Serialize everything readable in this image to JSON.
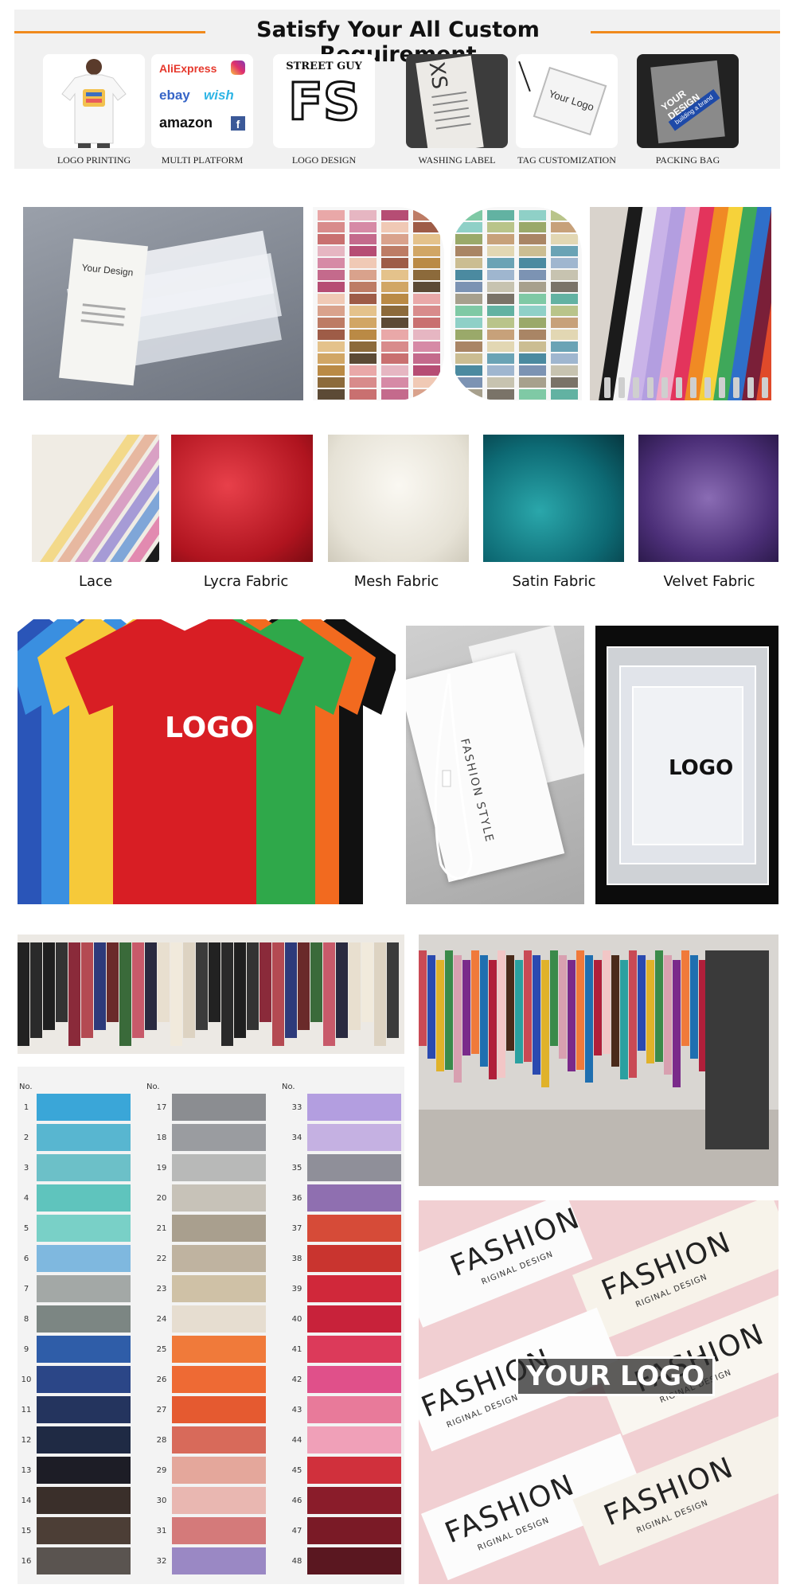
{
  "header": {
    "title": "Satisfy Your All Custom Requirement",
    "accent_color": "#f08a1c",
    "tiles": [
      {
        "caption": "LOGO PRINTING"
      },
      {
        "caption": "MULTI PLATFORM",
        "brands": [
          "AliExpress",
          "ebay",
          "wish",
          "amazon"
        ]
      },
      {
        "caption": "LOGO DESIGN",
        "logo_text": "STREET GUY",
        "logo_letters": "FS"
      },
      {
        "caption": "WASHING LABEL",
        "size": "XS"
      },
      {
        "caption": "TAG CUSTOMIZATION",
        "tag_text": "Your Logo"
      },
      {
        "caption": "PACKING BAG",
        "bag_text": "YOUR DESIGN",
        "bag_sub": "building a brand"
      }
    ]
  },
  "packaging": {
    "bag_text": "Your Design"
  },
  "fabrics": [
    {
      "label": "Lace"
    },
    {
      "label": "Lycra Fabric"
    },
    {
      "label": "Mesh Fabric"
    },
    {
      "label": "Satin Fabric"
    },
    {
      "label": "Velvet Fabric"
    }
  ],
  "custom": {
    "tshirt_logo": "LOGO",
    "hang_tag_text": "FASHION STYLE",
    "bag_logo": "LOGO"
  },
  "swatch_card": {
    "no_label": "No.",
    "col1_numbers": [
      "1",
      "2",
      "3",
      "4",
      "5",
      "6",
      "7",
      "8",
      "9",
      "10",
      "11",
      "12",
      "13",
      "14",
      "15",
      "16"
    ],
    "col2_numbers": [
      "17",
      "18",
      "19",
      "20",
      "21",
      "22",
      "23",
      "24",
      "25",
      "26",
      "27",
      "28",
      "29",
      "30",
      "31",
      "32"
    ],
    "col3_numbers": [
      "33",
      "34",
      "35",
      "36",
      "37",
      "38",
      "39",
      "40",
      "41",
      "42",
      "43",
      "44",
      "45",
      "46",
      "47",
      "48"
    ],
    "col1_colors": [
      "#3aa6d8",
      "#58b6d0",
      "#6cc0c8",
      "#5fc4bd",
      "#79d0c7",
      "#7fb8df",
      "#a3a8a6",
      "#7c8683",
      "#2f5da8",
      "#2b4687",
      "#24345e",
      "#1f2a44",
      "#1d1d26",
      "#3a2f2a",
      "#4c3e36",
      "#5a5450"
    ],
    "col2_colors": [
      "#8b8d91",
      "#9a9ca0",
      "#b8b9b8",
      "#c7c2b8",
      "#a99f8e",
      "#bfb3a0",
      "#cfc1a6",
      "#e6ddd0",
      "#f07a3a",
      "#ee6a34",
      "#e55a30",
      "#d86a5a",
      "#e4a79b",
      "#e9b7b1",
      "#d47a7a",
      "#9a88c4"
    ],
    "col3_colors": [
      "#b39ee0",
      "#c5b1e2",
      "#8f8f99",
      "#8f6fb0",
      "#d64b38",
      "#c9342f",
      "#d0283a",
      "#c8223a",
      "#dc3a5a",
      "#e0508a",
      "#e87a9a",
      "#f0a0b8",
      "#d0303c",
      "#8a1c2a",
      "#7a1a26",
      "#5a1720"
    ]
  },
  "labels_photo": {
    "fashion_text": "FASHION",
    "riginal_text": "RIGINAL DESIGN",
    "your_logo": "YOUR LOGO"
  }
}
